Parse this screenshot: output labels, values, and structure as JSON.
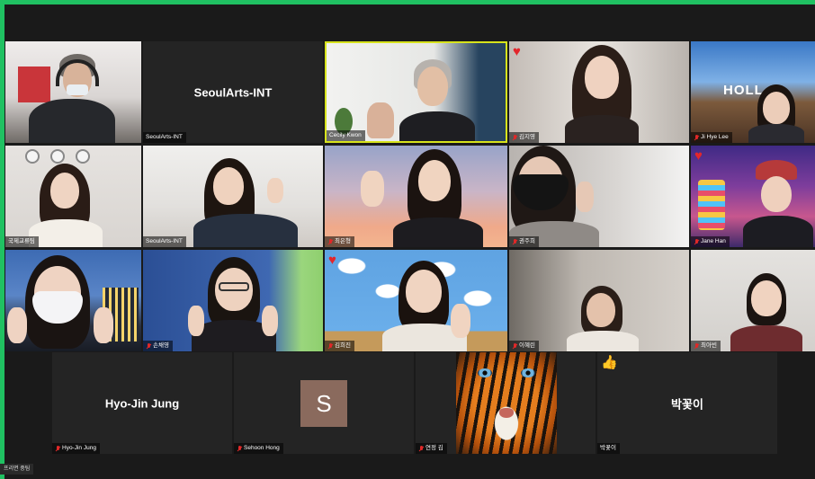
{
  "meeting": {
    "footer_text": "프리면 중팀"
  },
  "colors": {
    "share_border": "#20c162",
    "active_speaker": "#d7e31c",
    "muted_mic": "#e02828"
  },
  "tiles": [
    {
      "name": "",
      "muted": false
    },
    {
      "name": "SeoulArts-INT",
      "center": "SeoulArts-INT",
      "muted": false
    },
    {
      "name": "Cecily Kwon",
      "muted": false,
      "active": true
    },
    {
      "name": "김지영",
      "muted": true,
      "reaction": "heart"
    },
    {
      "name": "Ji Hye Lee",
      "muted": true
    },
    {
      "name": "국제교류팀",
      "muted": false
    },
    {
      "name": "SeoulArts-INT",
      "muted": false
    },
    {
      "name": "최은형",
      "muted": true
    },
    {
      "name": "권주희",
      "muted": true
    },
    {
      "name": "Jane Han",
      "muted": true,
      "reaction": "heart"
    },
    {
      "name": "",
      "muted": false
    },
    {
      "name": "손채영",
      "muted": true
    },
    {
      "name": "김희진",
      "muted": true,
      "reaction": "heart"
    },
    {
      "name": "이혜린",
      "muted": true
    },
    {
      "name": "최아빈",
      "muted": true
    }
  ],
  "bottom_tiles": [
    {
      "name": "Hyo-Jin Jung",
      "center": "Hyo-Jin Jung",
      "muted": true
    },
    {
      "name": "Sehoon Hong",
      "avatar": "S",
      "muted": true
    },
    {
      "name": "연정 김",
      "muted": true
    },
    {
      "name": "박꽃이",
      "center": "박꽃이",
      "muted": false,
      "reaction": "thumbs-up"
    }
  ]
}
